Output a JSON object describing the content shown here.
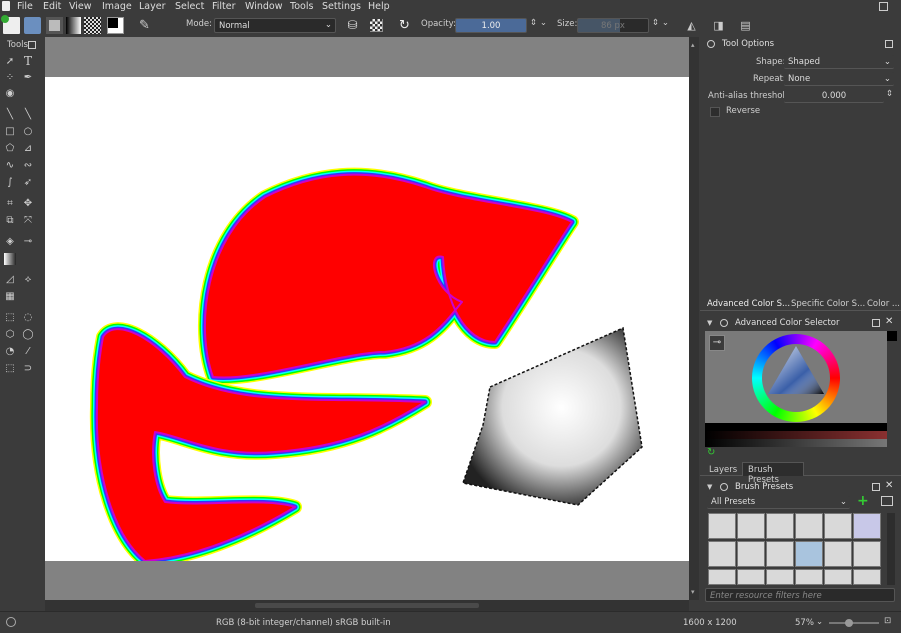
{
  "menu": [
    "File",
    "Edit",
    "View",
    "Image",
    "Layer",
    "Select",
    "Filter",
    "Window",
    "Tools",
    "Settings",
    "Help"
  ],
  "toolbar": {
    "mode_label": "Mode:",
    "mode_value": "Normal",
    "opacity_label": "Opacity:",
    "opacity_value": "1.00",
    "size_label": "Size:",
    "size_value": "86 px"
  },
  "toolbox": {
    "title": "Tools"
  },
  "tool_options": {
    "title": "Tool Options",
    "shape_label": "Shape:",
    "shape_value": "Shaped",
    "repeat_label": "Repeat:",
    "repeat_value": "None",
    "aa_label": "Anti-alias threshold:",
    "aa_value": "0.000",
    "reverse_label": "Reverse"
  },
  "color_tabs": [
    "Advanced Color S...",
    "Specific Color S...",
    "Color ..."
  ],
  "color_selector": {
    "title": "Advanced Color Selector"
  },
  "preset_tabs": [
    "Layers",
    "Brush Presets"
  ],
  "brush_presets": {
    "title": "Brush Presets",
    "filter_value": "All Presets",
    "search_placeholder": "Enter resource filters here"
  },
  "status": {
    "color_info": "RGB (8-bit integer/channel)  sRGB built-in",
    "dimensions": "1600 x 1200",
    "zoom": "57%"
  },
  "colors": {
    "accent": "#4b6a98",
    "background": "#3b3b3b"
  }
}
